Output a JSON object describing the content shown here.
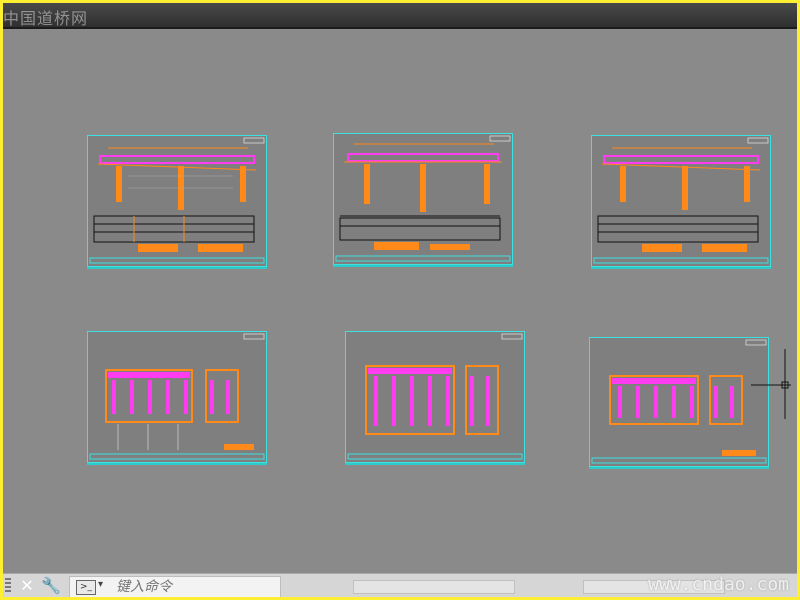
{
  "app": {
    "title_watermark": "中国道桥网",
    "brand_watermark": "www.cndao.com"
  },
  "command": {
    "placeholder": "键入命令"
  },
  "colors": {
    "background": "#8a8a8a",
    "sheet_border": "#3ee0e0",
    "drawing_orange": "#ff8a1a",
    "drawing_magenta": "#ff3cf0",
    "frame": "#ffef33"
  },
  "icons": {
    "close": "close-icon",
    "settings": "wrench-icon",
    "command": "command-line-icon",
    "cursor": "crosshair-cursor-icon"
  }
}
